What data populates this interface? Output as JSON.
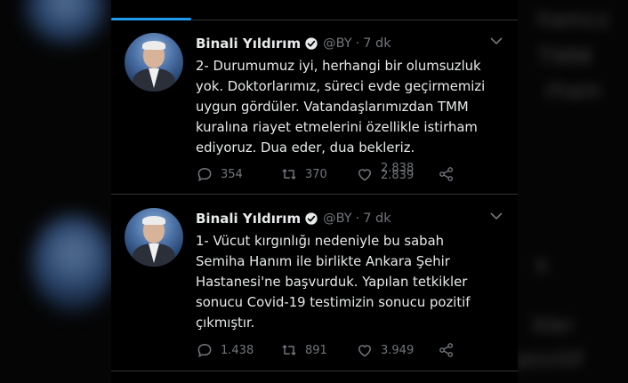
{
  "background": {
    "blurred_text": [
      "hamcz",
      "TMM",
      "rham",
      "s",
      "kler",
      "pozitif"
    ]
  },
  "tweets": [
    {
      "name": "Binali Yıldırım",
      "handle": "@BY",
      "separator": "·",
      "time": "7 dk",
      "text": "2- Durumumuz iyi, herhangi bir olumsuzluk\nyok. Doktorlarımız, süreci evde geçirmemizi\nuygun gördüler. Vatandaşlarımızdan TMM\nkuralına riayet etmelerini özellikle istirham\nediyoruz. Dua eder, dua bekleriz.",
      "replies": "354",
      "retweets": "370",
      "likes_old": "2.838",
      "likes_new": "2.839"
    },
    {
      "name": "Binali Yıldırım",
      "handle": "@BY",
      "separator": "·",
      "time": "7 dk",
      "text": "1- Vücut kırgınlığı nedeniyle bu sabah\nSemiha Hanım ile birlikte Ankara Şehir\nHastanesi'ne başvurduk. Yapılan tetkikler\nsonucu Covid-19 testimizin sonucu pozitif\nçıkmıştır.",
      "replies": "1.438",
      "retweets": "891",
      "likes": "3.949"
    }
  ],
  "colors": {
    "accent": "#1d9bf0",
    "text": "#e7e9ea",
    "muted": "#71767b",
    "divider": "#2f3336"
  }
}
